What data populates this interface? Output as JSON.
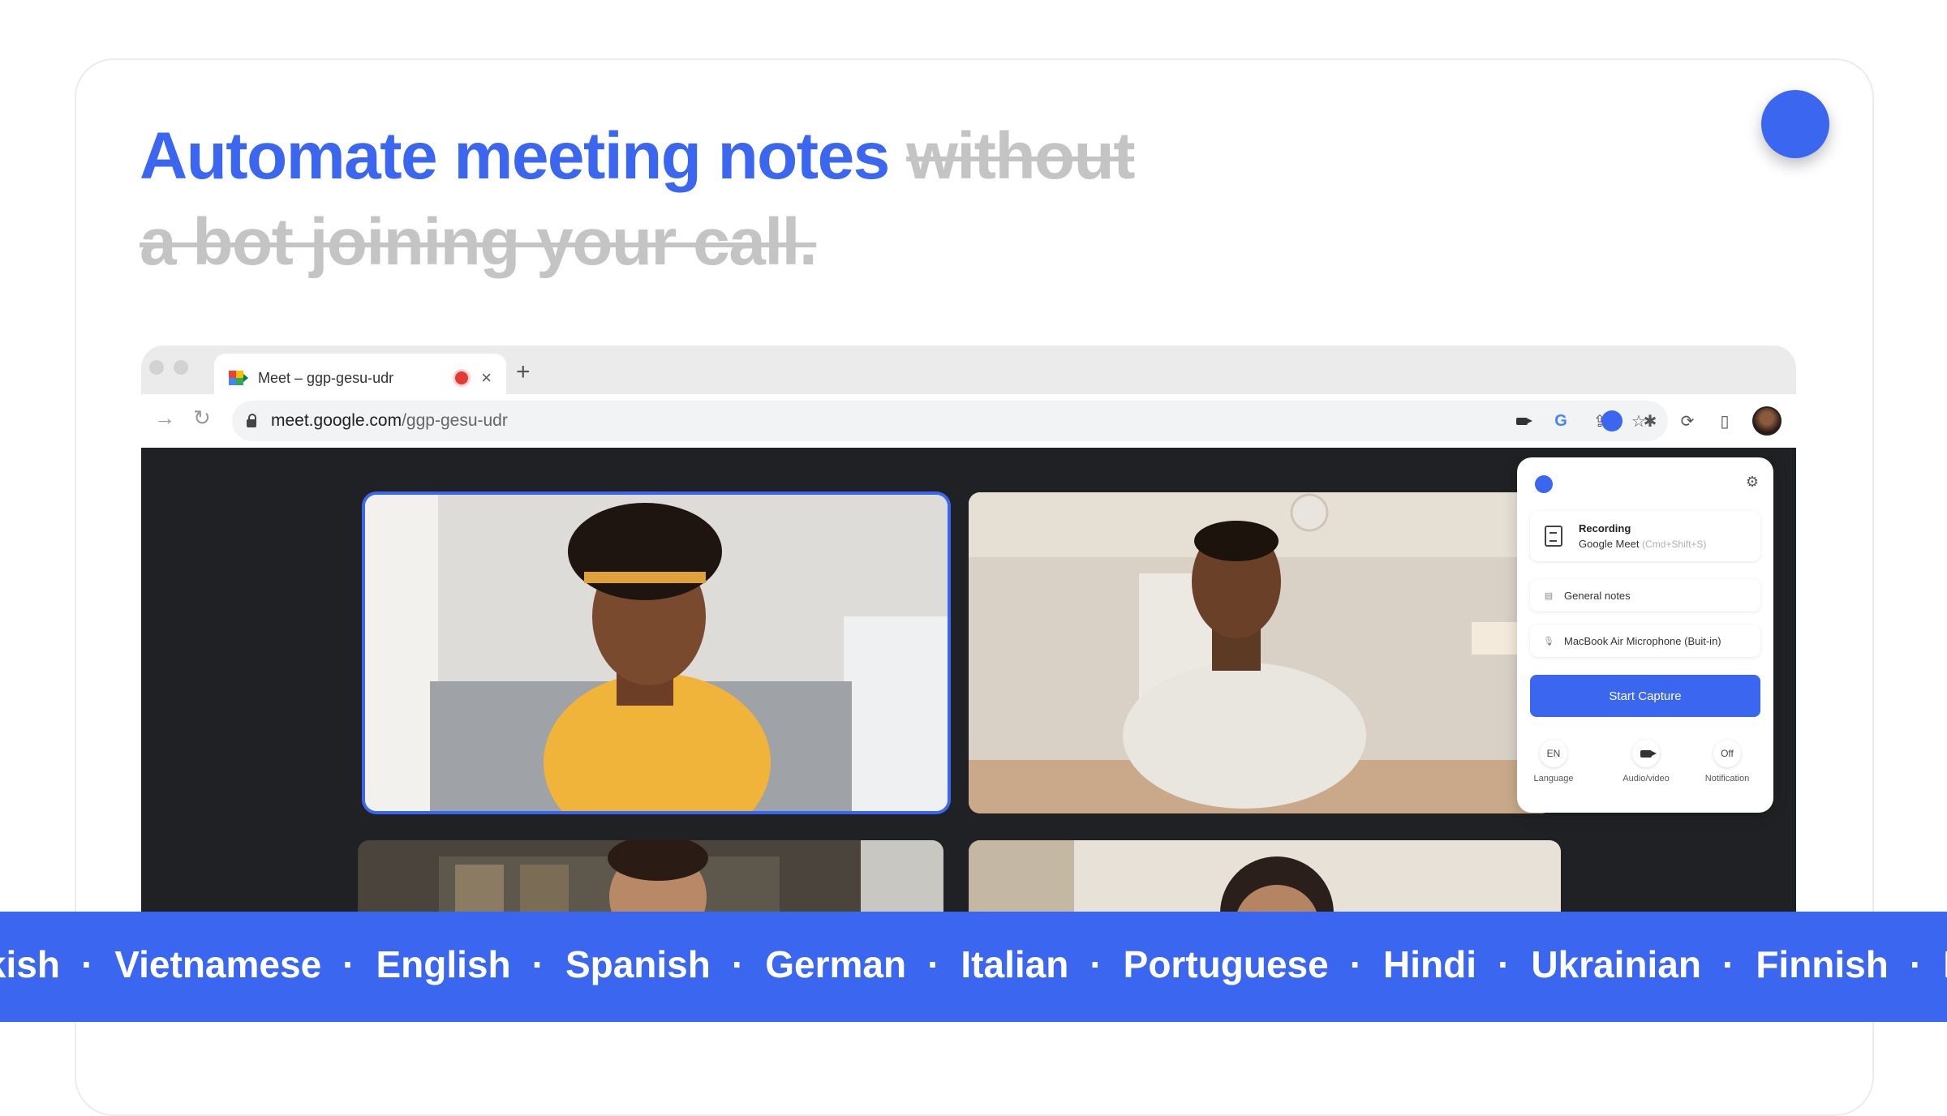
{
  "headline": {
    "highlight": "Automate meeting notes",
    "strike_line1": "without",
    "strike_line2": "a bot joining your call."
  },
  "browser": {
    "tab_title": "Meet – ggp-gesu-udr",
    "url_host": "meet.google.com",
    "url_path": "/ggp-gesu-udr",
    "new_tab": "+",
    "close_tab": "×"
  },
  "popup": {
    "recording_title": "Recording",
    "recording_app": "Google Meet",
    "recording_shortcut": "(Cmd+Shift+S)",
    "notes_label": "General notes",
    "mic_label": "MacBook Air Microphone (Buit-in)",
    "start_button": "Start Capture",
    "options": [
      {
        "value": "EN",
        "label": "Language"
      },
      {
        "value": "",
        "label": "Audio/video"
      },
      {
        "value": "Off",
        "label": "Notification"
      }
    ]
  },
  "languages": [
    "rkish",
    "Vietnamese",
    "English",
    "Spanish",
    "German",
    "Italian",
    "Portuguese",
    "Hindi",
    "Ukrainian",
    "Finnish",
    "Korean"
  ],
  "language_separator": "·",
  "colors": {
    "accent": "#3a66f0",
    "strike": "#c4c4c4",
    "meet_bg": "#202124"
  }
}
